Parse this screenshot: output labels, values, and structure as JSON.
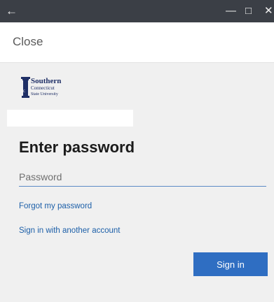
{
  "window": {
    "back_icon": "arrow-left-icon",
    "back_glyph": "←",
    "minimize_glyph": "—",
    "maximize_glyph": "□",
    "close_glyph": "✕"
  },
  "header": {
    "close_label": "Close"
  },
  "logo": {
    "line1": "Southern",
    "line2": "Connecticut",
    "line3": "State University"
  },
  "form": {
    "title": "Enter password",
    "password_placeholder": "Password",
    "password_value": "",
    "forgot_label": "Forgot my password",
    "another_account_label": "Sign in with another account",
    "signin_label": "Sign in"
  },
  "colors": {
    "titlebar": "#3b3f46",
    "accent": "#2f6ec2",
    "link": "#1c5fa8",
    "background": "#f0f0f0"
  }
}
